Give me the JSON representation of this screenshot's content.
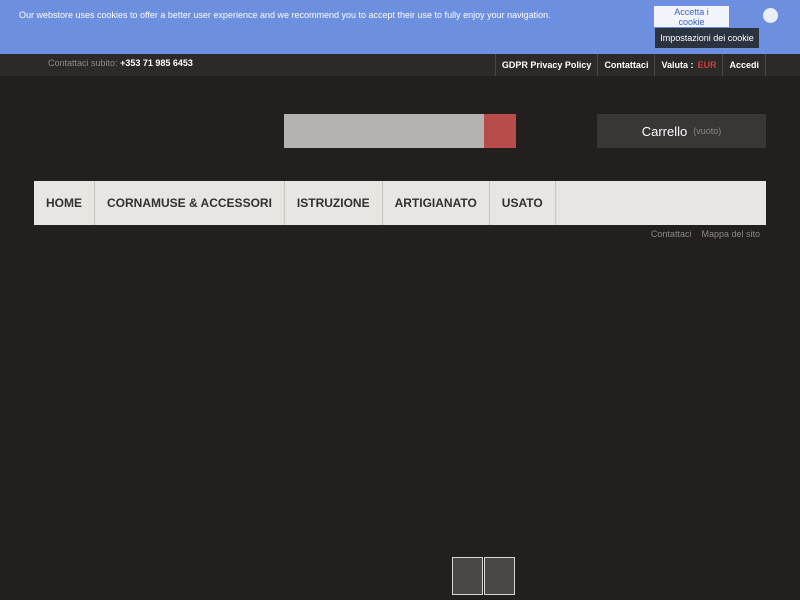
{
  "cookie": {
    "message": "Our webstore uses cookies to offer a better user experience and we recommend you to accept their use to fully enjoy your navigation.",
    "accept_label": "Accetta i cookie",
    "settings_label": "Impostazioni dei cookie"
  },
  "topbar": {
    "contact_prefix": "Contattaci subito:",
    "phone": "+353 71 985 6453",
    "links": {
      "privacy": "GDPR Privacy Policy",
      "contact": "Contattaci",
      "currency_label": "Valuta :",
      "currency_value": "EUR",
      "login": "Accedi"
    }
  },
  "cart": {
    "label": "Carrello",
    "status": "(vuoto)"
  },
  "nav": {
    "items": [
      "HOME",
      "CORNAMUSE & ACCESSORI",
      "ISTRUZIONE",
      "ARTIGIANATO",
      "USATO"
    ]
  },
  "sublinks": {
    "contact": "Contattaci",
    "sitemap": "Mappa del sito"
  },
  "colors": {
    "background": "#231f1e",
    "cookie_bar": "#6c8fdf",
    "accent": "#b84c4a",
    "nav_bg": "#e8e6e2"
  },
  "icons": {
    "cookie_close": "close-icon",
    "search": "search-icon"
  }
}
